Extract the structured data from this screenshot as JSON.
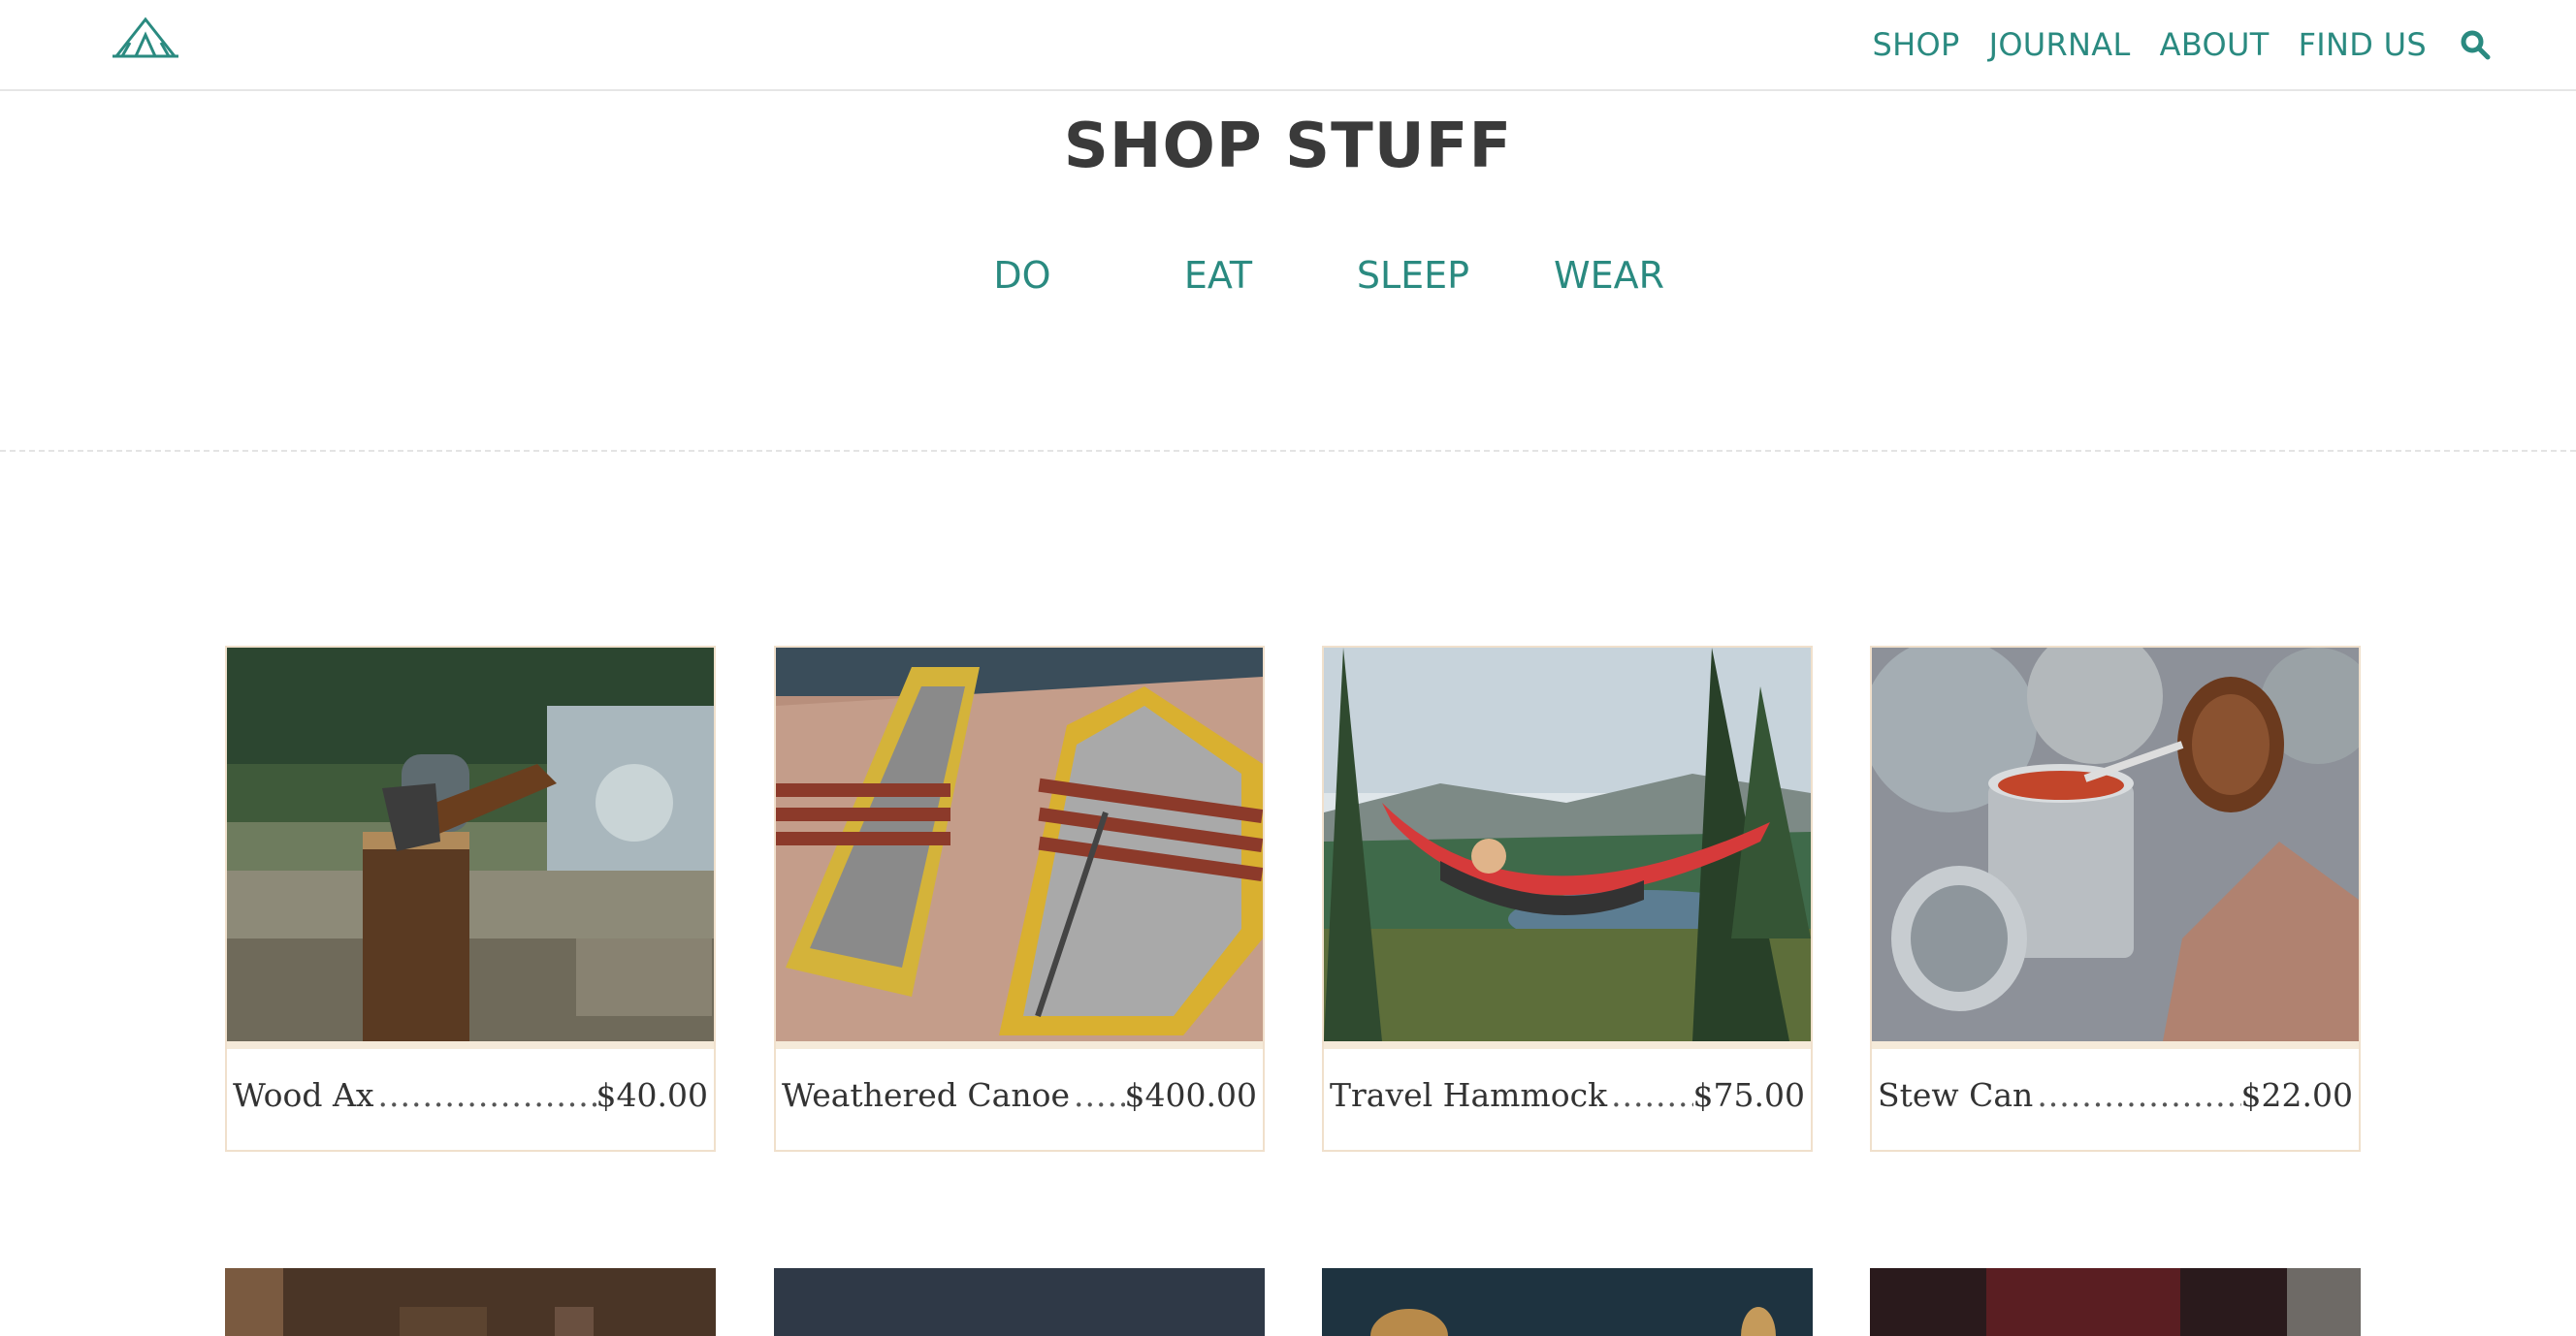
{
  "header": {
    "nav": [
      "SHOP",
      "JOURNAL",
      "ABOUT",
      "FIND US"
    ]
  },
  "page": {
    "title": "SHOP STUFF",
    "categories": [
      "DO",
      "EAT",
      "SLEEP",
      "WEAR"
    ]
  },
  "products": [
    {
      "name": "Wood Ax",
      "price": "$40.00"
    },
    {
      "name": "Weathered Canoe",
      "price": "$400.00"
    },
    {
      "name": "Travel Hammock",
      "price": "$75.00"
    },
    {
      "name": "Stew Can",
      "price": "$22.00"
    }
  ],
  "colors": {
    "accent": "#2a8a80",
    "title": "#3a3a3a",
    "card_border": "#f0e0cc"
  }
}
